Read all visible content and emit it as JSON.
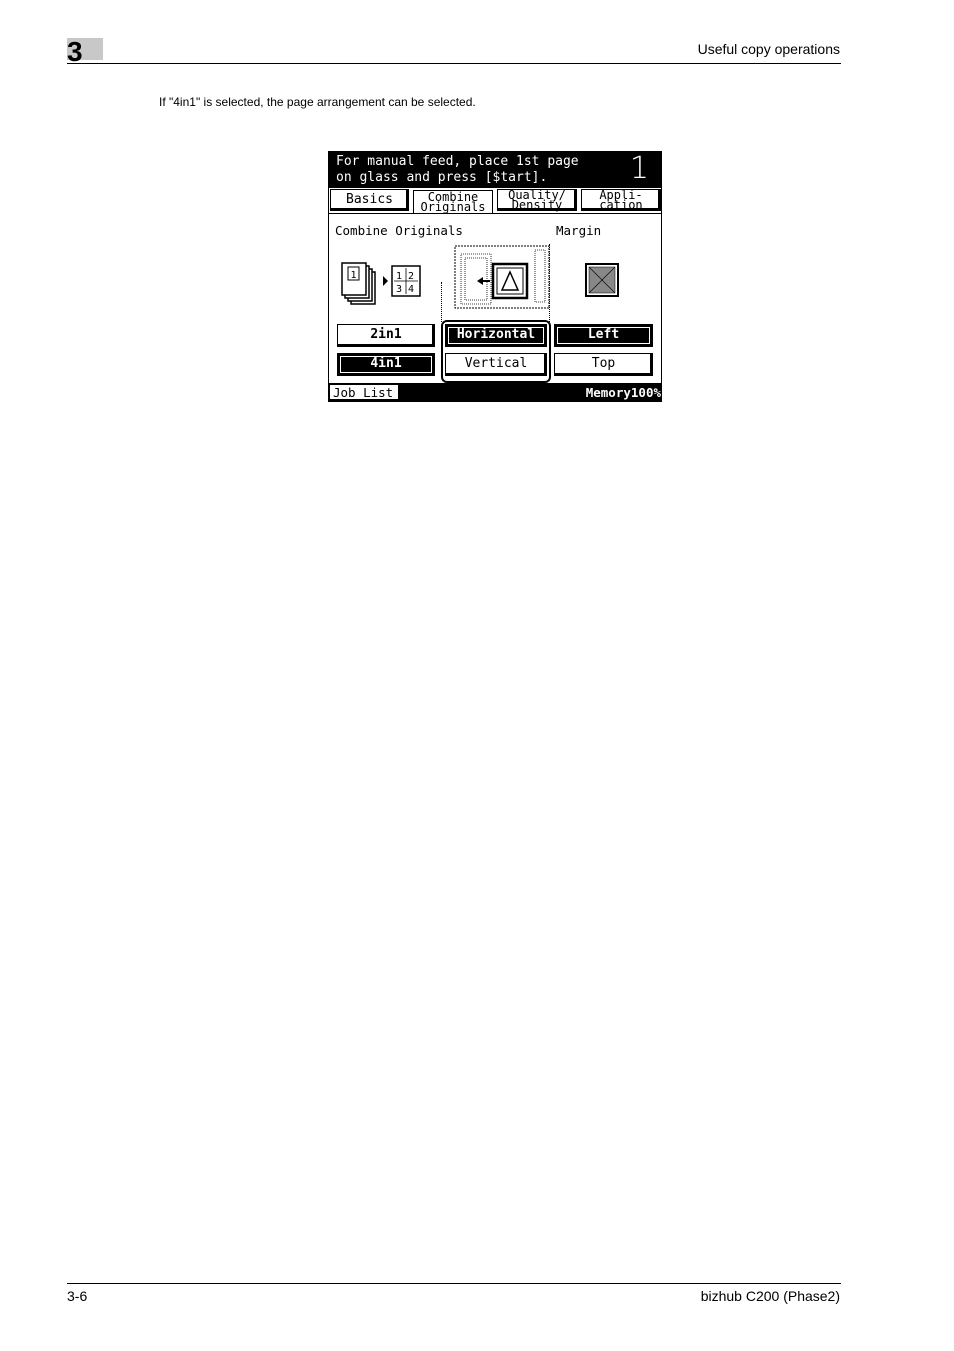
{
  "header": {
    "chapter": "3",
    "title": "Useful copy operations"
  },
  "intro": "If \"4in1\" is selected, the page arrangement can be selected.",
  "panel": {
    "message_line1": "For manual feed, place 1st page",
    "message_line2": "on glass and press [$tart].",
    "copies": "1",
    "tabs": [
      {
        "line1": "Basics",
        "line2": ""
      },
      {
        "line1": "Combine",
        "line2": "Originals"
      },
      {
        "line1": "Quality/",
        "line2": "Density"
      },
      {
        "line1": "Appli-",
        "line2": "cation"
      }
    ],
    "combine_label": "Combine Originals",
    "margin_label": "Margin",
    "buttons": {
      "b2in1": "2in1",
      "b4in1": "4in1",
      "horizontal": "Horizontal",
      "vertical": "Vertical",
      "left": "Left",
      "top": "Top"
    },
    "job_list": "Job List",
    "memory": "Memory100%",
    "icon_pages": [
      "1",
      "1",
      "2",
      "3",
      "4"
    ]
  },
  "footer": {
    "page": "3-6",
    "product": "bizhub C200 (Phase2)"
  }
}
